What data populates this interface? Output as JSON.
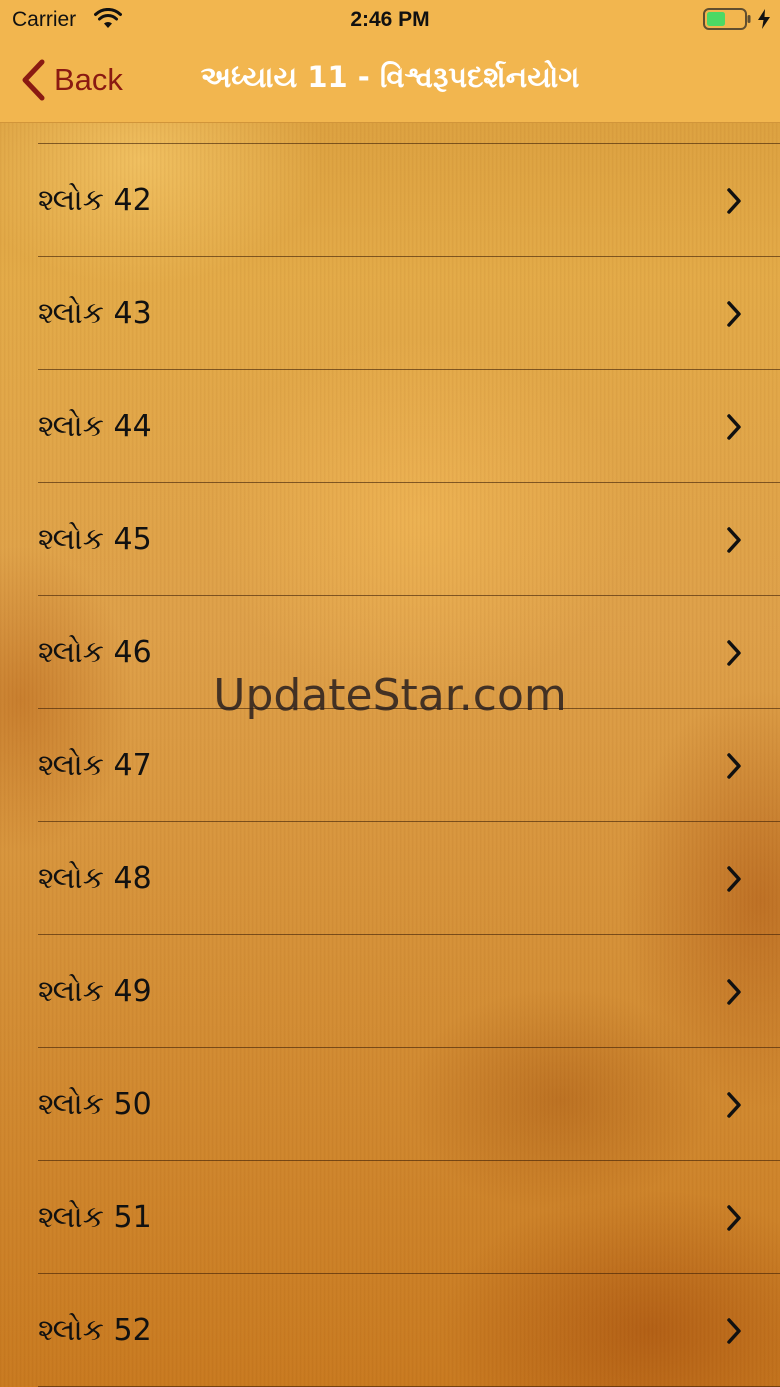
{
  "status_bar": {
    "carrier": "Carrier",
    "time": "2:46 PM",
    "wifi_icon": "wifi-icon",
    "battery_icon": "battery-charging-icon",
    "battery_level": 0.5,
    "battery_color": "#4cd964"
  },
  "nav": {
    "back_label": "Back",
    "title": "અધ્યાય 11 - વિશ્વરૂપદર્શનયોગ",
    "back_color": "#8a1a12",
    "background_color": "#f2b64f"
  },
  "list": {
    "chevron_icon": "chevron-right-icon",
    "items": [
      {
        "label": "શ્લોક 42"
      },
      {
        "label": "શ્લોક 43"
      },
      {
        "label": "શ્લોક 44"
      },
      {
        "label": "શ્લોક 45"
      },
      {
        "label": "શ્લોક 46"
      },
      {
        "label": "શ્લોક 47"
      },
      {
        "label": "શ્લોક 48"
      },
      {
        "label": "શ્લોક 49"
      },
      {
        "label": "શ્લોક 50"
      },
      {
        "label": "શ્લોક 51"
      },
      {
        "label": "શ્લોક 52"
      }
    ]
  },
  "watermark": "UpdateStar.com"
}
